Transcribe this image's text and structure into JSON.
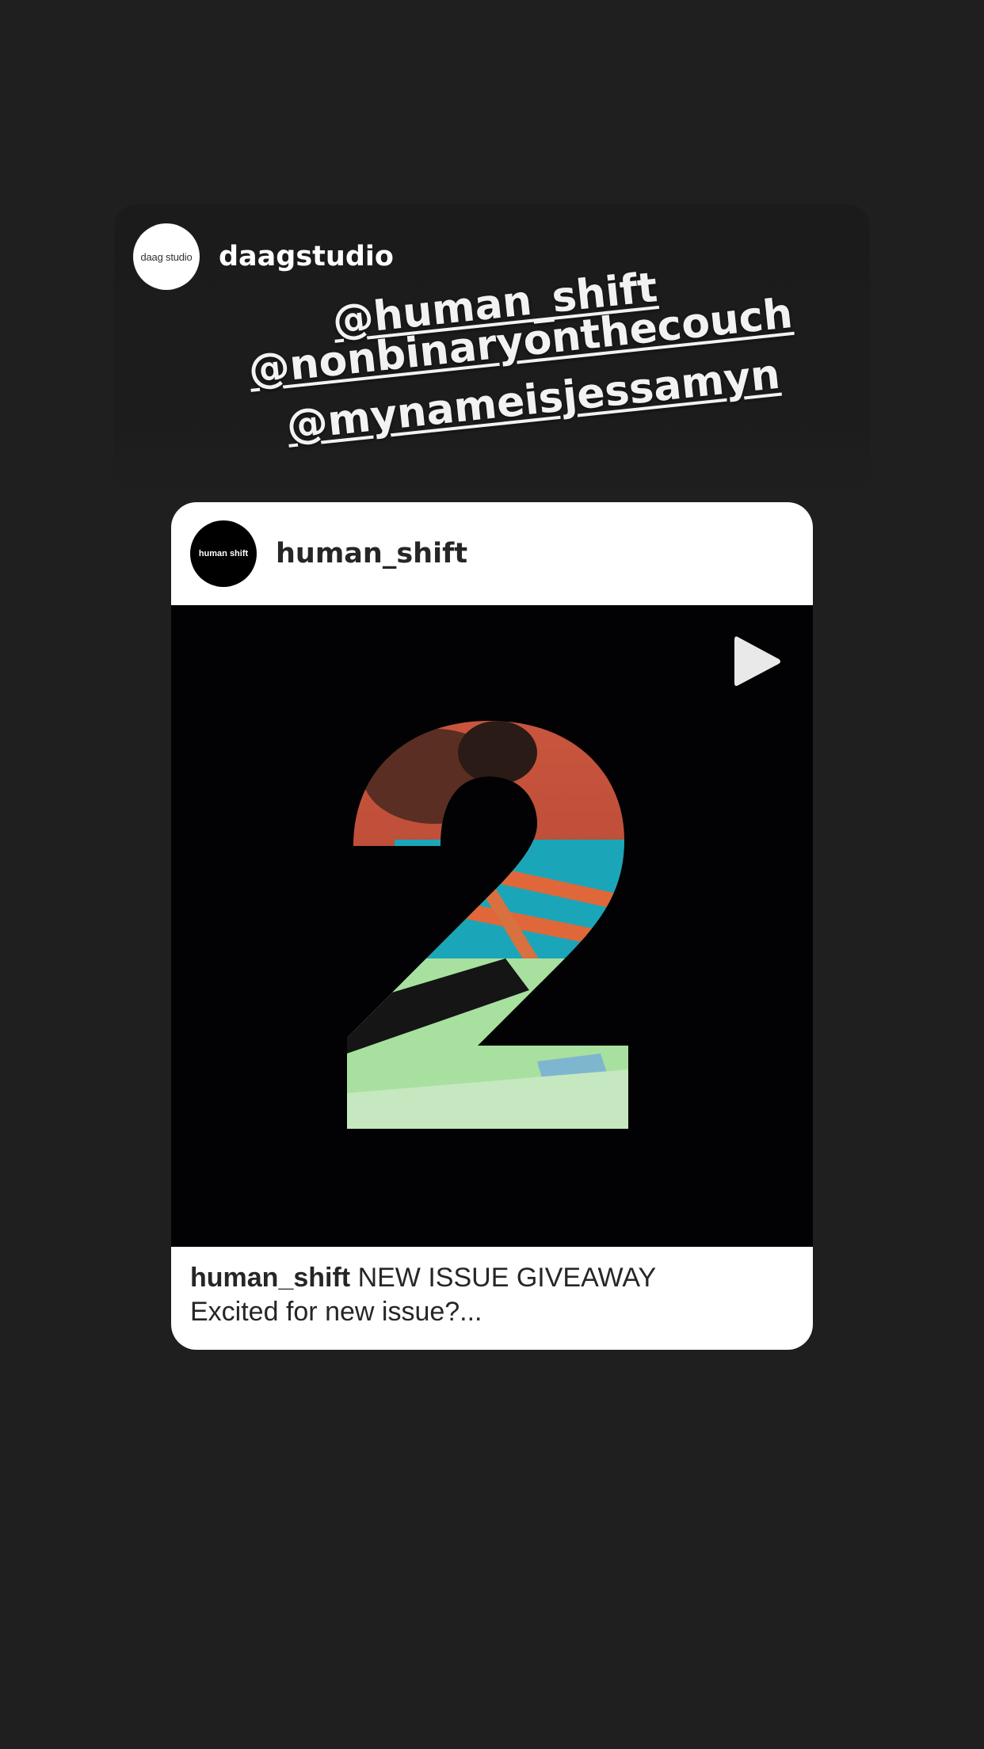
{
  "story": {
    "username": "daagstudio",
    "avatar_text": "daag studio",
    "mentions": [
      "@human_shift",
      "@nonbinaryonthecouch",
      "@mynameisjessamyn"
    ]
  },
  "post": {
    "username": "human_shift",
    "avatar_text": "human shift",
    "media_type": "video",
    "numeral": "2",
    "caption_user": "human_shift",
    "caption_text": " NEW ISSUE GIVEAWAY",
    "caption_line2": "Excited for new issue?..."
  },
  "colors": {
    "background": "#1f1f1f",
    "card_white": "#ffffff",
    "media_black": "#020104",
    "text_dark": "#262626"
  }
}
